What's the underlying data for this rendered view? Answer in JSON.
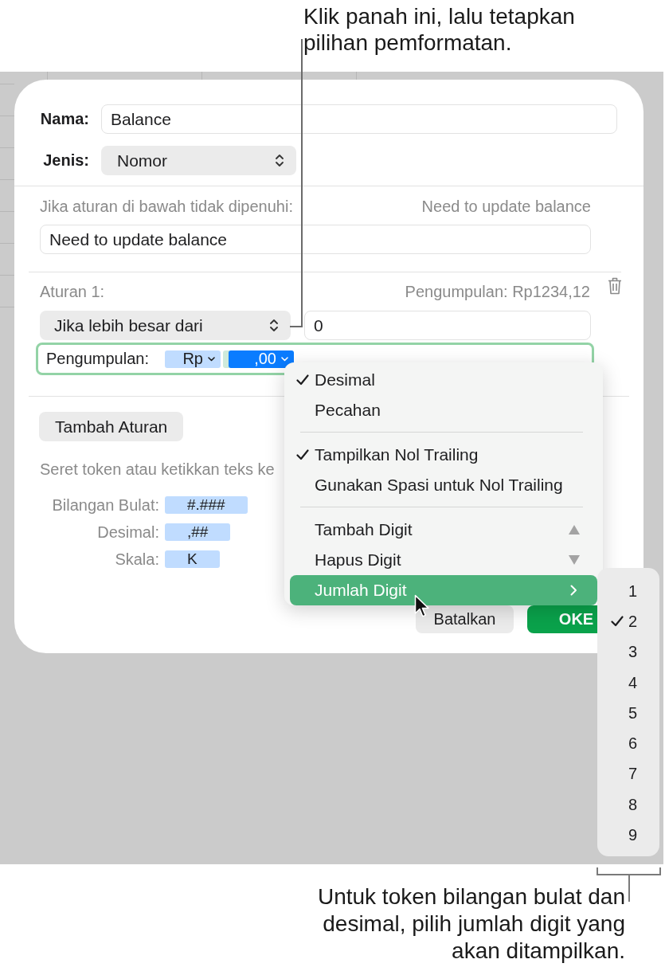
{
  "callout_top": {
    "text": "Klik panah ini, lalu tetapkan pilihan pemformatan."
  },
  "dialog": {
    "name_field": {
      "label": "Nama:",
      "value": "Balance"
    },
    "type_field": {
      "label": "Jenis:",
      "value": "Nomor"
    },
    "fallback": {
      "label": "Jika aturan di bawah tidak dipenuhi:",
      "preview": "Need to update balance",
      "value": "Need to update balance"
    },
    "rule": {
      "title": "Aturan 1:",
      "preview": "Pengumpulan: Rp1234,12",
      "condition": "Jika lebih besar dari",
      "value": "0",
      "format": {
        "label": "Pengumpulan:",
        "tokens": [
          {
            "text": "Rp",
            "selected": false
          },
          {
            "text": ",00",
            "selected": true
          }
        ]
      }
    },
    "add_rule_button": "Tambah Aturan",
    "hint": "Seret token atau ketikkan teks ke",
    "token_palette": [
      {
        "label": "Bilangan Bulat:",
        "token": "#.###"
      },
      {
        "label": "Desimal:",
        "token": ",##"
      },
      {
        "label": "Skala:",
        "token": "K"
      }
    ],
    "buttons": [
      {
        "label": "Batalkan",
        "kind": "secondary"
      },
      {
        "label": "OKE",
        "kind": "primary"
      }
    ]
  },
  "menu": {
    "items": [
      {
        "kind": "option",
        "label": "Desimal",
        "checked": true,
        "selected": false
      },
      {
        "kind": "option",
        "label": "Pecahan",
        "checked": false,
        "selected": false
      },
      {
        "kind": "separator"
      },
      {
        "kind": "option",
        "label": "Tampilkan Nol Trailing",
        "checked": true,
        "selected": false
      },
      {
        "kind": "option",
        "label": "Gunakan Spasi untuk Nol Trailing",
        "checked": false,
        "selected": false
      },
      {
        "kind": "separator"
      },
      {
        "kind": "increment",
        "label": "Tambah Digit",
        "checked": false,
        "selected": false
      },
      {
        "kind": "decrement",
        "label": "Hapus Digit",
        "checked": false,
        "selected": false
      },
      {
        "kind": "submenu",
        "label": "Jumlah Digit",
        "checked": false,
        "selected": true
      }
    ]
  },
  "submenu": {
    "items": [
      {
        "label": "1",
        "checked": false
      },
      {
        "label": "2",
        "checked": true
      },
      {
        "label": "3",
        "checked": false
      },
      {
        "label": "4",
        "checked": false
      },
      {
        "label": "5",
        "checked": false
      },
      {
        "label": "6",
        "checked": false
      },
      {
        "label": "7",
        "checked": false
      },
      {
        "label": "8",
        "checked": false
      },
      {
        "label": "9",
        "checked": false
      }
    ]
  },
  "callout_bottom": {
    "text": "Untuk token bilangan bulat dan desimal, pilih jumlah digit yang akan ditampilkan."
  }
}
